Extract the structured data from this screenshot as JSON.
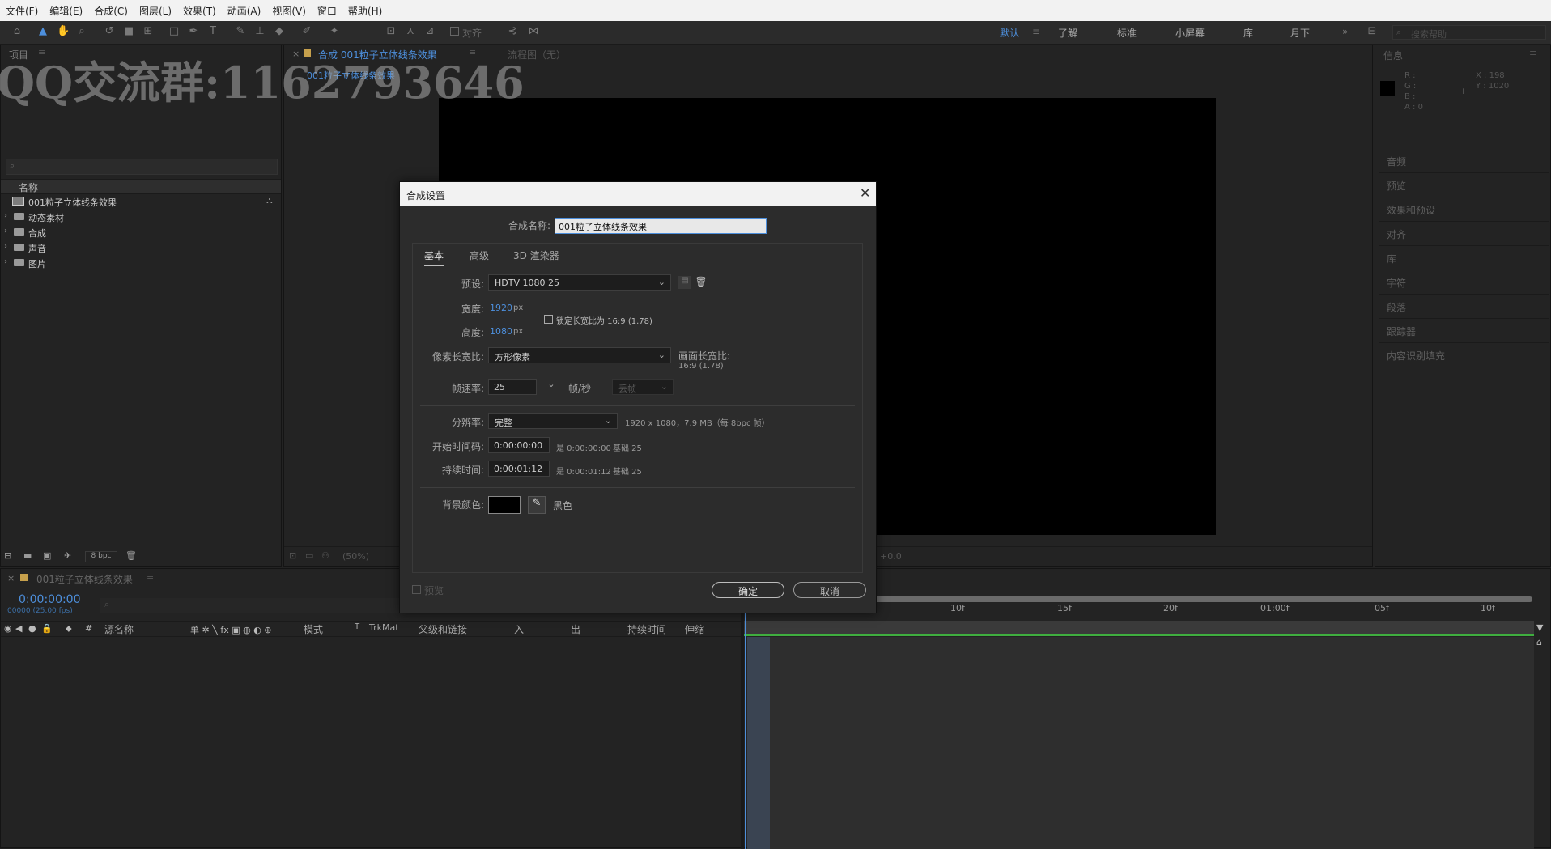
{
  "menu": [
    "文件(F)",
    "编辑(E)",
    "合成(C)",
    "图层(L)",
    "效果(T)",
    "动画(A)",
    "视图(V)",
    "窗口",
    "帮助(H)"
  ],
  "toolbar": {
    "snap_label": "对齐"
  },
  "workspaces": {
    "items": [
      "默认",
      "了解",
      "标准",
      "小屏幕",
      "库",
      "月下"
    ],
    "active": "默认",
    "search_placeholder": "搜索帮助"
  },
  "watermark": "QQ交流群:1162793646",
  "project_panel": {
    "tab": "项目",
    "selected_comp_label": "001粒子立体线条效果",
    "column_name": "名称",
    "items": [
      {
        "label": "001粒子立体线条效果",
        "type": "comp"
      },
      {
        "label": "动态素材",
        "type": "folder"
      },
      {
        "label": "合成",
        "type": "folder"
      },
      {
        "label": "声音",
        "type": "folder"
      },
      {
        "label": "图片",
        "type": "folder"
      }
    ],
    "bpc": "8 bpc"
  },
  "comp_panel": {
    "tab": "合成 001粒子立体线条效果",
    "flowchart": "流程图（无）",
    "zoom": "(50%)",
    "offset": "+0.0"
  },
  "info_panel": {
    "title": "信息",
    "r": "R :",
    "g": "G :",
    "b": "B :",
    "a": "A : 0",
    "x": "X : 198",
    "y": "Y : 1020"
  },
  "right_panels": [
    "音频",
    "预览",
    "效果和预设",
    "对齐",
    "库",
    "字符",
    "段落",
    "跟踪器",
    "内容识别填充"
  ],
  "dialog": {
    "title": "合成设置",
    "name_label": "合成名称:",
    "name_value": "001粒子立体线条效果",
    "tabs": [
      "基本",
      "高级",
      "3D 渲染器"
    ],
    "preset_label": "预设:",
    "preset_value": "HDTV 1080 25",
    "width_label": "宽度:",
    "width_value": "1920",
    "height_label": "高度:",
    "height_value": "1080",
    "px": "px",
    "lock_label": "锁定长宽比为 16:9 (1.78)",
    "par_label": "像素长宽比:",
    "par_value": "方形像素",
    "frame_ar_label": "画面长宽比:",
    "frame_ar_value": "16:9 (1.78)",
    "fps_label": "帧速率:",
    "fps_value": "25",
    "fps_unit": "帧/秒",
    "drop_frame": "丢帧",
    "resolution_label": "分辨率:",
    "resolution_value": "完整",
    "resolution_info": "1920 x 1080，7.9 MB（每 8bpc 帧）",
    "start_label": "开始时间码:",
    "start_value": "0:00:00:00",
    "start_info": "是 0:00:00:00",
    "start_base": "基础 25",
    "duration_label": "持续时间:",
    "duration_value": "0:00:01:12",
    "duration_info": "是 0:00:01:12",
    "duration_base": "基础 25",
    "bg_label": "背景颜色:",
    "bg_color": "#000000",
    "bg_name": "黑色",
    "preview_label": "预览",
    "ok": "确定",
    "cancel": "取消"
  },
  "timeline": {
    "tab": "001粒子立体线条效果",
    "timecode": "0:00:00:00",
    "timecode_sub": "00000 (25.00 fps)",
    "columns": [
      "源名称",
      "模式",
      "T",
      "TrkMat",
      "父级和链接",
      "入",
      "出",
      "持续时间",
      "伸缩"
    ],
    "ruler": [
      "10f",
      "15f",
      "20f",
      "01:00f",
      "05f",
      "10f"
    ]
  }
}
